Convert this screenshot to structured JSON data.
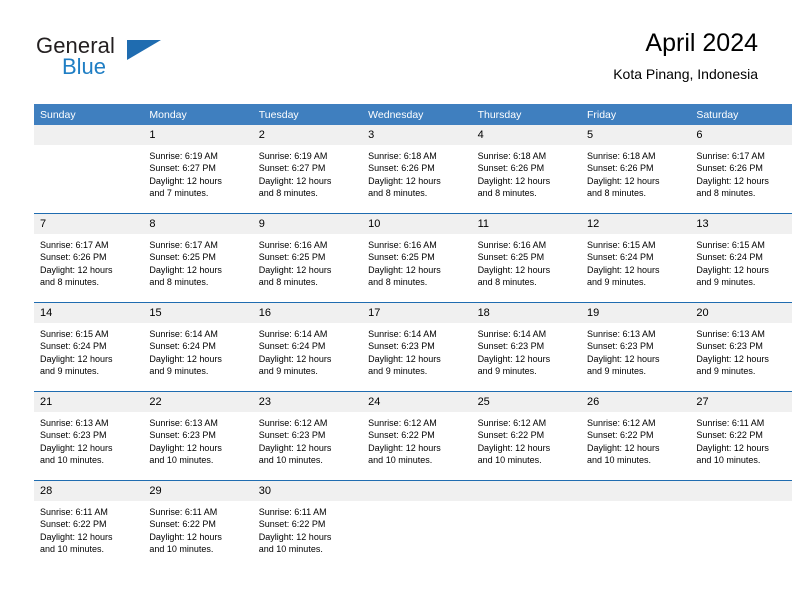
{
  "logo": {
    "word_top": "General",
    "word_bottom": "Blue",
    "triangle_color": "#1f6cb0",
    "blue_text_color": "#1f7ec4"
  },
  "header": {
    "title": "April 2024",
    "location": "Kota Pinang, Indonesia"
  },
  "theme": {
    "header_blue": "#3f7fbf",
    "rule_blue": "#1f6cb0",
    "daynum_band": "#f0f0f0"
  },
  "labels": {
    "sunrise_prefix": "Sunrise:",
    "sunset_prefix": "Sunset:",
    "daylight_prefix": "Daylight:"
  },
  "weekday_headers": [
    "Sunday",
    "Monday",
    "Tuesday",
    "Wednesday",
    "Thursday",
    "Friday",
    "Saturday"
  ],
  "weeks": [
    [
      {
        "day": "",
        "lines": []
      },
      {
        "day": "1",
        "lines": [
          "Sunrise: 6:19 AM",
          "Sunset: 6:27 PM",
          "Daylight: 12 hours",
          "and 7 minutes."
        ]
      },
      {
        "day": "2",
        "lines": [
          "Sunrise: 6:19 AM",
          "Sunset: 6:27 PM",
          "Daylight: 12 hours",
          "and 8 minutes."
        ]
      },
      {
        "day": "3",
        "lines": [
          "Sunrise: 6:18 AM",
          "Sunset: 6:26 PM",
          "Daylight: 12 hours",
          "and 8 minutes."
        ]
      },
      {
        "day": "4",
        "lines": [
          "Sunrise: 6:18 AM",
          "Sunset: 6:26 PM",
          "Daylight: 12 hours",
          "and 8 minutes."
        ]
      },
      {
        "day": "5",
        "lines": [
          "Sunrise: 6:18 AM",
          "Sunset: 6:26 PM",
          "Daylight: 12 hours",
          "and 8 minutes."
        ]
      },
      {
        "day": "6",
        "lines": [
          "Sunrise: 6:17 AM",
          "Sunset: 6:26 PM",
          "Daylight: 12 hours",
          "and 8 minutes."
        ]
      }
    ],
    [
      {
        "day": "7",
        "lines": [
          "Sunrise: 6:17 AM",
          "Sunset: 6:26 PM",
          "Daylight: 12 hours",
          "and 8 minutes."
        ]
      },
      {
        "day": "8",
        "lines": [
          "Sunrise: 6:17 AM",
          "Sunset: 6:25 PM",
          "Daylight: 12 hours",
          "and 8 minutes."
        ]
      },
      {
        "day": "9",
        "lines": [
          "Sunrise: 6:16 AM",
          "Sunset: 6:25 PM",
          "Daylight: 12 hours",
          "and 8 minutes."
        ]
      },
      {
        "day": "10",
        "lines": [
          "Sunrise: 6:16 AM",
          "Sunset: 6:25 PM",
          "Daylight: 12 hours",
          "and 8 minutes."
        ]
      },
      {
        "day": "11",
        "lines": [
          "Sunrise: 6:16 AM",
          "Sunset: 6:25 PM",
          "Daylight: 12 hours",
          "and 8 minutes."
        ]
      },
      {
        "day": "12",
        "lines": [
          "Sunrise: 6:15 AM",
          "Sunset: 6:24 PM",
          "Daylight: 12 hours",
          "and 9 minutes."
        ]
      },
      {
        "day": "13",
        "lines": [
          "Sunrise: 6:15 AM",
          "Sunset: 6:24 PM",
          "Daylight: 12 hours",
          "and 9 minutes."
        ]
      }
    ],
    [
      {
        "day": "14",
        "lines": [
          "Sunrise: 6:15 AM",
          "Sunset: 6:24 PM",
          "Daylight: 12 hours",
          "and 9 minutes."
        ]
      },
      {
        "day": "15",
        "lines": [
          "Sunrise: 6:14 AM",
          "Sunset: 6:24 PM",
          "Daylight: 12 hours",
          "and 9 minutes."
        ]
      },
      {
        "day": "16",
        "lines": [
          "Sunrise: 6:14 AM",
          "Sunset: 6:24 PM",
          "Daylight: 12 hours",
          "and 9 minutes."
        ]
      },
      {
        "day": "17",
        "lines": [
          "Sunrise: 6:14 AM",
          "Sunset: 6:23 PM",
          "Daylight: 12 hours",
          "and 9 minutes."
        ]
      },
      {
        "day": "18",
        "lines": [
          "Sunrise: 6:14 AM",
          "Sunset: 6:23 PM",
          "Daylight: 12 hours",
          "and 9 minutes."
        ]
      },
      {
        "day": "19",
        "lines": [
          "Sunrise: 6:13 AM",
          "Sunset: 6:23 PM",
          "Daylight: 12 hours",
          "and 9 minutes."
        ]
      },
      {
        "day": "20",
        "lines": [
          "Sunrise: 6:13 AM",
          "Sunset: 6:23 PM",
          "Daylight: 12 hours",
          "and 9 minutes."
        ]
      }
    ],
    [
      {
        "day": "21",
        "lines": [
          "Sunrise: 6:13 AM",
          "Sunset: 6:23 PM",
          "Daylight: 12 hours",
          "and 10 minutes."
        ]
      },
      {
        "day": "22",
        "lines": [
          "Sunrise: 6:13 AM",
          "Sunset: 6:23 PM",
          "Daylight: 12 hours",
          "and 10 minutes."
        ]
      },
      {
        "day": "23",
        "lines": [
          "Sunrise: 6:12 AM",
          "Sunset: 6:23 PM",
          "Daylight: 12 hours",
          "and 10 minutes."
        ]
      },
      {
        "day": "24",
        "lines": [
          "Sunrise: 6:12 AM",
          "Sunset: 6:22 PM",
          "Daylight: 12 hours",
          "and 10 minutes."
        ]
      },
      {
        "day": "25",
        "lines": [
          "Sunrise: 6:12 AM",
          "Sunset: 6:22 PM",
          "Daylight: 12 hours",
          "and 10 minutes."
        ]
      },
      {
        "day": "26",
        "lines": [
          "Sunrise: 6:12 AM",
          "Sunset: 6:22 PM",
          "Daylight: 12 hours",
          "and 10 minutes."
        ]
      },
      {
        "day": "27",
        "lines": [
          "Sunrise: 6:11 AM",
          "Sunset: 6:22 PM",
          "Daylight: 12 hours",
          "and 10 minutes."
        ]
      }
    ],
    [
      {
        "day": "28",
        "lines": [
          "Sunrise: 6:11 AM",
          "Sunset: 6:22 PM",
          "Daylight: 12 hours",
          "and 10 minutes."
        ]
      },
      {
        "day": "29",
        "lines": [
          "Sunrise: 6:11 AM",
          "Sunset: 6:22 PM",
          "Daylight: 12 hours",
          "and 10 minutes."
        ]
      },
      {
        "day": "30",
        "lines": [
          "Sunrise: 6:11 AM",
          "Sunset: 6:22 PM",
          "Daylight: 12 hours",
          "and 10 minutes."
        ]
      },
      {
        "day": "",
        "lines": []
      },
      {
        "day": "",
        "lines": []
      },
      {
        "day": "",
        "lines": []
      },
      {
        "day": "",
        "lines": []
      }
    ]
  ]
}
